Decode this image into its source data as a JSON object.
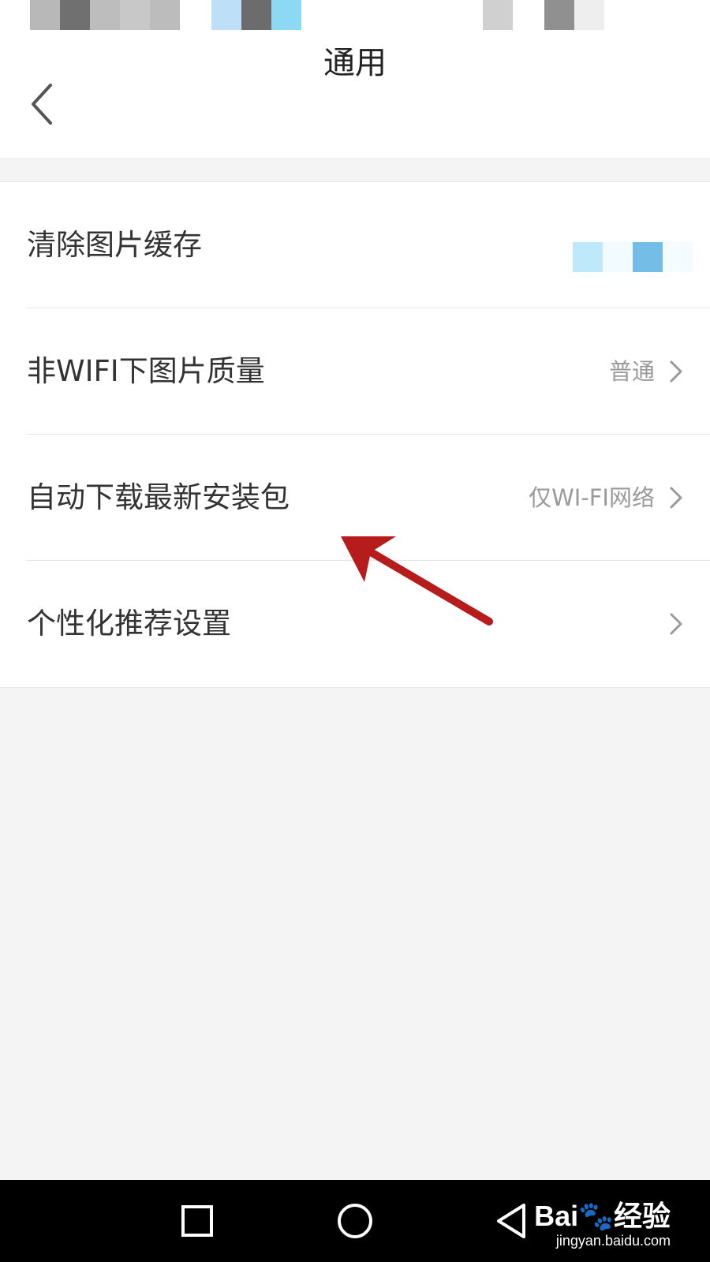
{
  "header": {
    "title": "通用"
  },
  "settings": [
    {
      "label": "清除图片缓存",
      "value": ""
    },
    {
      "label": "非WIFI下图片质量",
      "value": "普通"
    },
    {
      "label": "自动下载最新安装包",
      "value": "仅WI-FI网络"
    },
    {
      "label": "个性化推荐设置",
      "value": ""
    }
  ],
  "watermark": {
    "brand": "Bai",
    "brand_cn": "经验",
    "url": "jingyan.baidu.com"
  },
  "colors": {
    "annotation_arrow": "#b71c1c",
    "page_background": "#f4f4f4",
    "nav_bar": "#000000"
  },
  "icons": {
    "back": "chevron-left-icon",
    "row_arrow": "chevron-right-icon",
    "nav_recent": "square-icon",
    "nav_home": "circle-icon",
    "nav_back": "triangle-back-icon"
  }
}
